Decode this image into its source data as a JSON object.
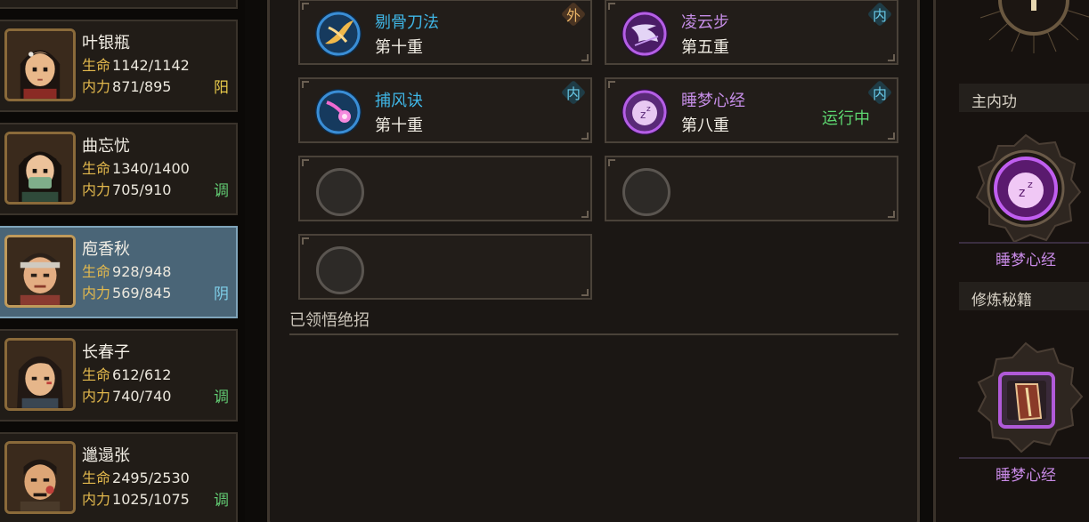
{
  "characters": [
    {
      "name": "叶银瓶",
      "hp_label": "生命",
      "hp": "1142/1142",
      "mp_label": "内力",
      "mp": "871/895",
      "affinity": "阳",
      "affinity_type": "yang",
      "selected": false
    },
    {
      "name": "曲忘忧",
      "hp_label": "生命",
      "hp": "1340/1400",
      "mp_label": "内力",
      "mp": "705/910",
      "affinity": "调",
      "affinity_type": "tiao",
      "selected": false
    },
    {
      "name": "庖香秋",
      "hp_label": "生命",
      "hp": "928/948",
      "mp_label": "内力",
      "mp": "569/845",
      "affinity": "阴",
      "affinity_type": "yin",
      "selected": true
    },
    {
      "name": "长春子",
      "hp_label": "生命",
      "hp": "612/612",
      "mp_label": "内力",
      "mp": "740/740",
      "affinity": "调",
      "affinity_type": "tiao",
      "selected": false
    },
    {
      "name": "邋遢张",
      "hp_label": "生命",
      "hp": "2495/2530",
      "mp_label": "内力",
      "mp": "1025/1075",
      "affinity": "调",
      "affinity_type": "tiao",
      "selected": false
    }
  ],
  "skills": [
    {
      "name": "剔骨刀法",
      "level": "第十重",
      "tag": "外",
      "tag_type": "wai",
      "icon": "blade-technique-icon",
      "name_color": "blue",
      "status": ""
    },
    {
      "name": "凌云步",
      "level": "第五重",
      "tag": "内",
      "tag_type": "nei",
      "icon": "cloud-step-icon",
      "name_color": "purple",
      "status": ""
    },
    {
      "name": "捕风诀",
      "level": "第十重",
      "tag": "内",
      "tag_type": "nei",
      "icon": "wind-catcher-icon",
      "name_color": "blue",
      "status": ""
    },
    {
      "name": "睡梦心经",
      "level": "第八重",
      "tag": "内",
      "tag_type": "nei",
      "icon": "dream-sutra-icon",
      "name_color": "purple",
      "status": "运行中"
    }
  ],
  "section_title": "已领悟绝招",
  "right_panel": {
    "main_inner_label": "主内功",
    "main_inner_name": "睡梦心经",
    "training_label": "修炼秘籍",
    "training_name": "睡梦心经"
  },
  "colors": {
    "accent_gold": "#e3b94d",
    "skill_blue": "#3fb6e6",
    "skill_purple": "#c58de6",
    "status_green": "#5dd670",
    "selected_card": "#4a6577"
  }
}
